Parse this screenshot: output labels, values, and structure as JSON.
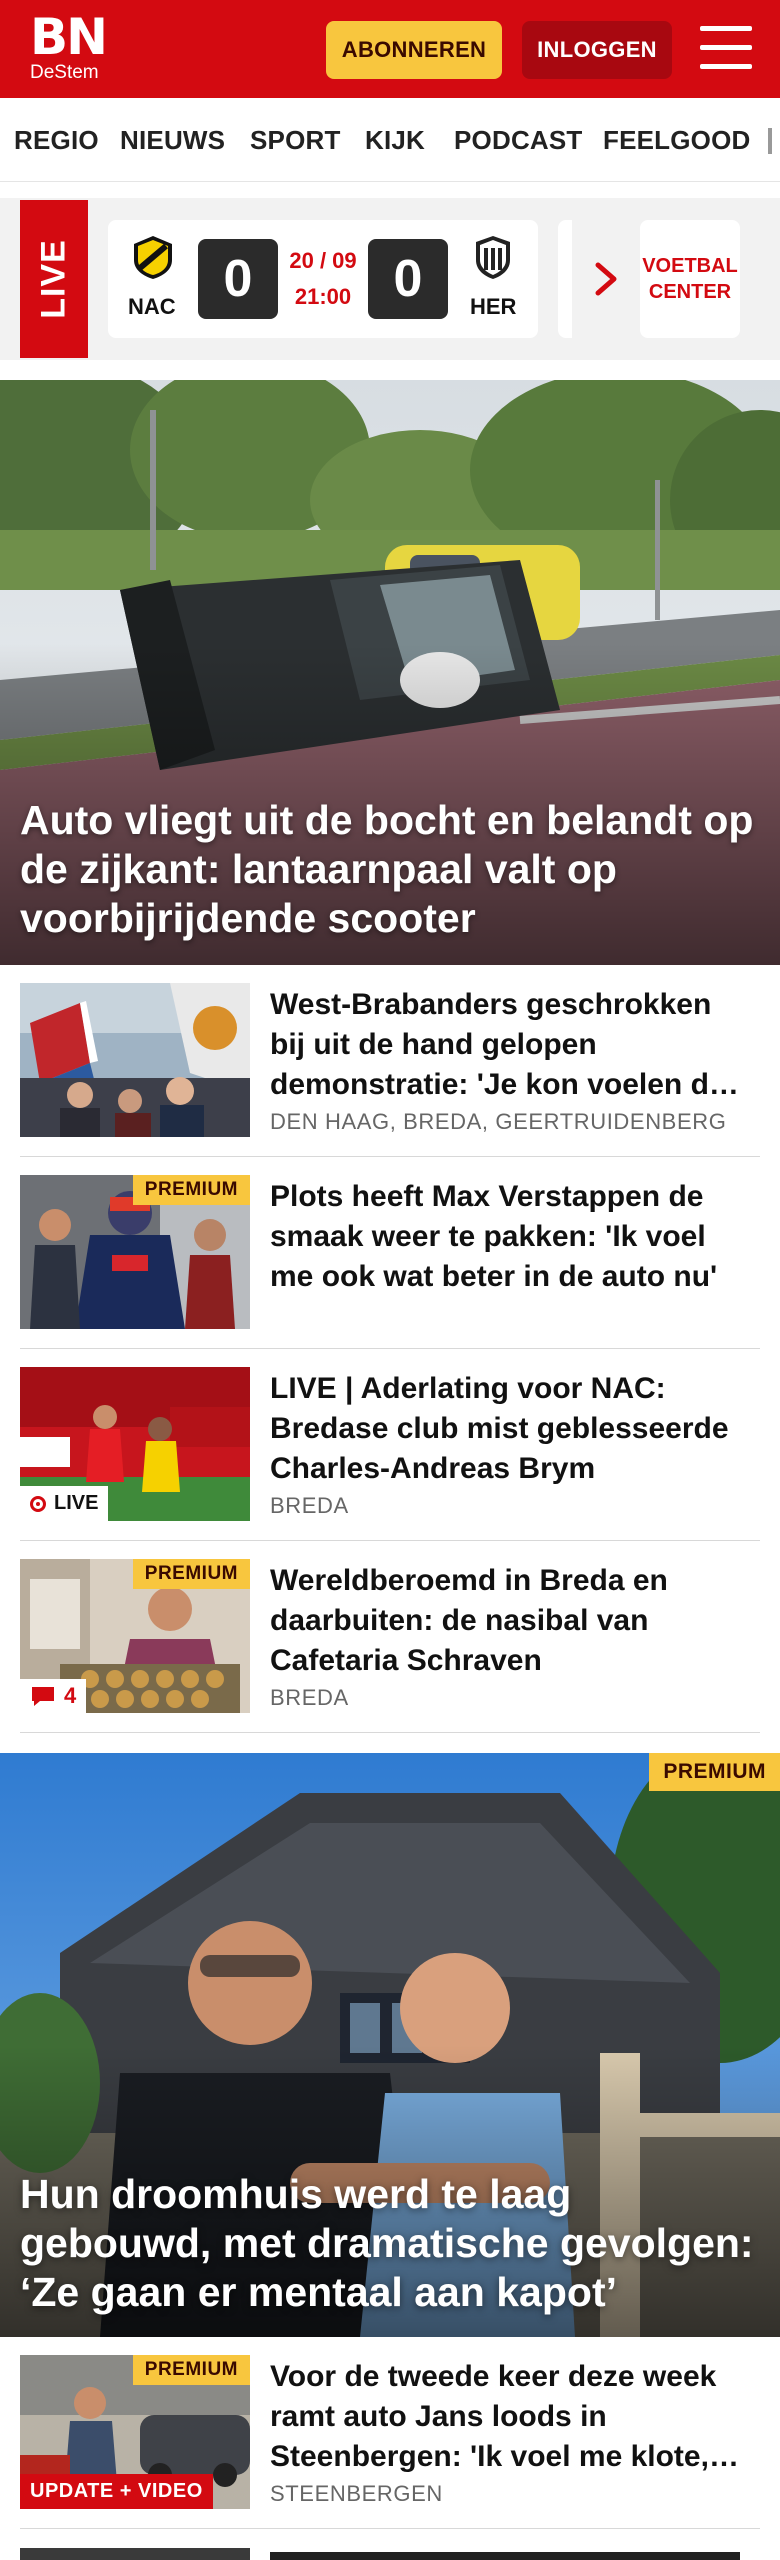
{
  "header": {
    "logo_main": "BN",
    "logo_sub": "DeStem",
    "subscribe_label": "ABONNEREN",
    "login_label": "INLOGGEN",
    "brand_color": "#d30a11",
    "icons": {
      "menu": "hamburger-menu-icon"
    }
  },
  "nav": {
    "items": [
      "REGIO",
      "NIEUWS",
      "SPORT",
      "KIJK",
      "PODCAST",
      "FEELGOOD"
    ]
  },
  "live": {
    "tag": "LIVE",
    "match": {
      "home": "NAC",
      "home_score": "0",
      "away": "HER",
      "away_score": "0",
      "date": "20 / 09",
      "time": "21:00"
    },
    "voetbal_center": "VOETBAL CENTER"
  },
  "hero": {
    "title": "Auto vliegt uit de bocht en belandt op de zijkant: lantaarnpaal valt op voorbijrijdende scooter"
  },
  "articles": [
    {
      "title": "West-Brabanders geschrokken bij uit de hand gelopen demonstratie: 'Je kon voelen dat het...",
      "location": "DEN HAAG, BREDA, GEERTRUIDENBERG",
      "badge": ""
    },
    {
      "title": "Plots heeft Max Verstappen de smaak weer te pakken: 'Ik voel me ook wat beter in de auto nu'",
      "location": "",
      "badge": "PREMIUM"
    },
    {
      "title": "LIVE | Aderlating voor NAC: Bredase club mist geblesseerde Charles-Andreas Brym",
      "location": "BREDA",
      "badge_live": "LIVE"
    },
    {
      "title": "Wereldberoemd in Breda en daarbuiten: de nasibal van Cafetaria Schraven",
      "location": "BREDA",
      "badge": "PREMIUM",
      "comments": "4"
    }
  ],
  "hero2": {
    "badge": "PREMIUM",
    "title": "Hun droomhuis werd te laag gebouwd, met dramatische gevolgen: ‘Ze gaan er mentaal aan kapot’"
  },
  "articles2": [
    {
      "title": "Voor de tweede keer deze week ramt auto Jans loods in Steenbergen: 'Ik voel me klote, ik...",
      "location": "STEENBERGEN",
      "badge": "PREMIUM",
      "update_badge": "UPDATE + VIDEO"
    }
  ]
}
